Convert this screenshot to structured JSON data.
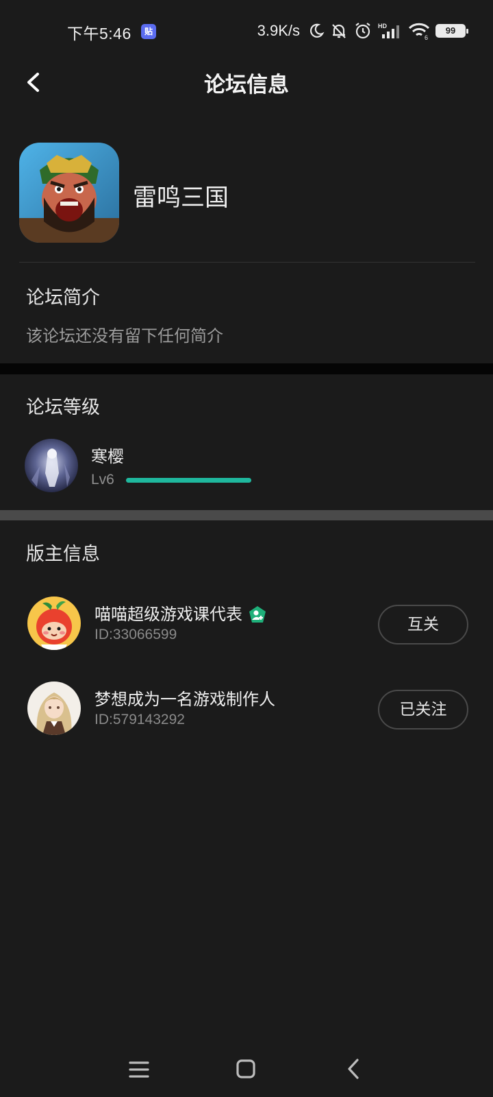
{
  "status_bar": {
    "time": "下午5:46",
    "badge": "贴",
    "net_speed": "3.9K/s",
    "battery": "99"
  },
  "header": {
    "title": "论坛信息"
  },
  "game": {
    "name": "雷鸣三国"
  },
  "intro": {
    "title": "论坛简介",
    "text": "该论坛还没有留下任何简介"
  },
  "level": {
    "title": "论坛等级",
    "user_name": "寒樱",
    "level_label": "Lv6",
    "progress": 1.0
  },
  "moderators": {
    "title": "版主信息",
    "items": [
      {
        "name": "喵喵超级游戏课代表",
        "id": "ID:33066599",
        "button": "互关",
        "verified": true
      },
      {
        "name": "梦想成为一名游戏制作人",
        "id": "ID:579143292",
        "button": "已关注",
        "verified": false
      }
    ]
  },
  "colors": {
    "background": "#1b1b1b",
    "accent": "#1fb89e",
    "verify_badge": "#1fb07a"
  },
  "icons": {
    "back": "chevron-left-icon",
    "menu": "menu-icon",
    "home": "home-square-icon",
    "nav_back": "nav-back-icon"
  }
}
